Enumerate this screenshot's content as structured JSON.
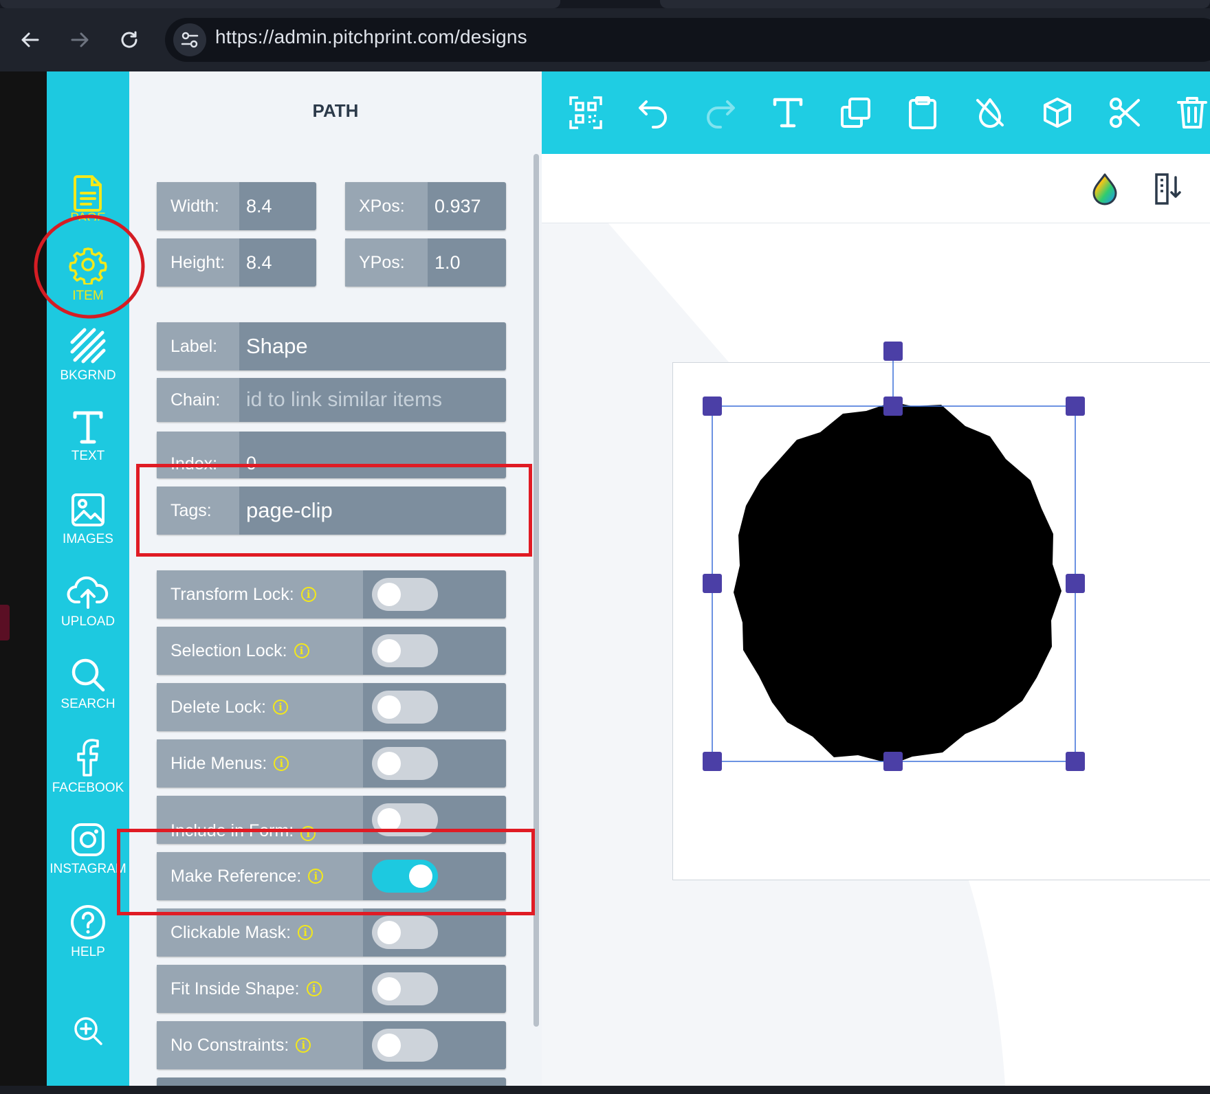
{
  "browser": {
    "url": "https://admin.pitchprint.com/designs"
  },
  "nav": {
    "items": [
      {
        "label": "PAGE",
        "icon": "document-icon"
      },
      {
        "label": "ITEM",
        "icon": "gear-icon"
      },
      {
        "label": "BKGRND",
        "icon": "stripes-icon"
      },
      {
        "label": "TEXT",
        "icon": "text-icon"
      },
      {
        "label": "IMAGES",
        "icon": "image-icon"
      },
      {
        "label": "UPLOAD",
        "icon": "cloud-upload-icon"
      },
      {
        "label": "SEARCH",
        "icon": "search-icon"
      },
      {
        "label": "FACEBOOK",
        "icon": "facebook-icon"
      },
      {
        "label": "INSTAGRAM",
        "icon": "instagram-icon"
      },
      {
        "label": "HELP",
        "icon": "help-icon"
      }
    ],
    "accent": "#f3e81a",
    "background": "#1dc9e0"
  },
  "panel": {
    "title": "PATH",
    "width": {
      "label": "Width:",
      "value": "8.4"
    },
    "height": {
      "label": "Height:",
      "value": "8.4"
    },
    "xpos": {
      "label": "XPos:",
      "value": "0.937"
    },
    "ypos": {
      "label": "YPos:",
      "value": "1.0"
    },
    "label_field": {
      "label": "Label:",
      "value": "Shape"
    },
    "chain": {
      "label": "Chain:",
      "placeholder": "id to link similar items"
    },
    "index": {
      "label": "Index:",
      "value": "0"
    },
    "tags": {
      "label": "Tags:",
      "value": "page-clip"
    },
    "toggles": [
      {
        "label": "Transform Lock:",
        "on": false
      },
      {
        "label": "Selection Lock:",
        "on": false
      },
      {
        "label": "Delete Lock:",
        "on": false
      },
      {
        "label": "Hide Menus:",
        "on": false
      },
      {
        "label": "Include in Form:",
        "on": false
      },
      {
        "label": "Make Reference:",
        "on": true
      },
      {
        "label": "Clickable Mask:",
        "on": false
      },
      {
        "label": "Fit Inside Shape:",
        "on": false
      },
      {
        "label": "No Constraints:",
        "on": false
      }
    ]
  },
  "toolbar": {
    "tools": [
      "qr-code-icon",
      "undo-icon",
      "redo-icon",
      "text-icon",
      "duplicate-icon",
      "clipboard-icon",
      "no-fill-icon",
      "cube-icon",
      "scissors-icon",
      "trash-icon"
    ]
  },
  "canvas": {
    "header_icons": [
      "color-drop-icon",
      "page-swap-icon"
    ],
    "shape_color": "#000000",
    "handle_color": "#4b3fa6"
  }
}
